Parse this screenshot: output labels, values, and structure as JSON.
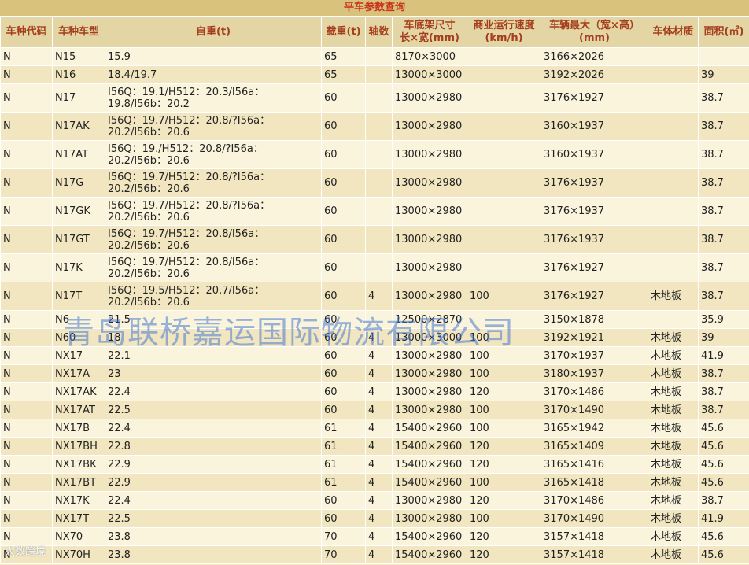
{
  "page": {
    "title": "平车参数查询"
  },
  "table": {
    "headers": [
      "车种代码",
      "车种车型",
      "自重(t)",
      "载重(t)",
      "轴数",
      "车底架尺寸\n长×宽(mm)",
      "商业运行速度\n(km/h)",
      "车辆最大（宽×高）\n(mm)",
      "车体材质",
      "面积(㎡)"
    ],
    "rows": [
      [
        "N",
        "N15",
        "15.9",
        "65",
        "",
        "8170×3000",
        "",
        "3166×2026",
        "",
        ""
      ],
      [
        "N",
        "N16",
        "18.4/19.7",
        "65",
        "",
        "13000×3000",
        "",
        "3192×2026",
        "",
        "39"
      ],
      [
        "N",
        "N17",
        "I56Q：19.1/H512：20.3/I56a：\n19.8/I56b：20.2",
        "60",
        "",
        "13000×2980",
        "",
        "3176×1927",
        "",
        "38.7"
      ],
      [
        "N",
        "N17AK",
        "I56Q：19.7/H512：20.8/?I56a：\n20.2/I56b：20.6",
        "60",
        "",
        "13000×2980",
        "",
        "3160×1937",
        "",
        "38.7"
      ],
      [
        "N",
        "N17AT",
        "I56Q：19./H512：20.8/?I56a：\n20.2/I56b：20.6",
        "60",
        "",
        "13000×2980",
        "",
        "3160×1937",
        "",
        "38.7"
      ],
      [
        "N",
        "N17G",
        "I56Q：19.7/H512：20.8/?I56a：\n20.2/I56b：20.6",
        "60",
        "",
        "13000×2980",
        "",
        "3176×1937",
        "",
        "38.7"
      ],
      [
        "N",
        "N17GK",
        "I56Q：19.7/H512：20.8/?I56a：\n20.2/I56b：20.6",
        "60",
        "",
        "13000×2980",
        "",
        "3176×1937",
        "",
        "38.7"
      ],
      [
        "N",
        "N17GT",
        "I56Q：19.7/H512：20.8/I56a：\n20.2/I56b：20.6",
        "60",
        "",
        "13000×2980",
        "",
        "3176×1937",
        "",
        "38.7"
      ],
      [
        "N",
        "N17K",
        "I56Q：19.7/H512：20.8/I56a：\n20.2/I56b：20.6",
        "60",
        "",
        "13000×2980",
        "",
        "3176×1927",
        "",
        "38.7"
      ],
      [
        "N",
        "N17T",
        "I56Q：19.5/H512：20.7/I56a：\n20.2/I56b：20.6",
        "60",
        "4",
        "13000×2980",
        "100",
        "3176×1927",
        "木地板",
        "38.7"
      ],
      [
        "N",
        "N6",
        "21.5",
        "60",
        "",
        "12500×2870",
        "",
        "3150×1878",
        "",
        "35.9"
      ],
      [
        "N",
        "N60",
        "18",
        "60",
        "4",
        "13000×3000",
        "100",
        "3192×1921",
        "木地板",
        "39"
      ],
      [
        "N",
        "NX17",
        "22.1",
        "60",
        "4",
        "13000×2980",
        "100",
        "3170×1937",
        "木地板",
        "41.9"
      ],
      [
        "N",
        "NX17A",
        "23",
        "60",
        "4",
        "13000×2980",
        "100",
        "3180×1937",
        "木地板",
        "38.7"
      ],
      [
        "N",
        "NX17AK",
        "22.4",
        "60",
        "4",
        "13000×2980",
        "120",
        "3170×1486",
        "木地板",
        "38.7"
      ],
      [
        "N",
        "NX17AT",
        "22.5",
        "60",
        "4",
        "13000×2980",
        "100",
        "3170×1490",
        "木地板",
        "38.7"
      ],
      [
        "N",
        "NX17B",
        "22.4",
        "61",
        "4",
        "15400×2960",
        "100",
        "3165×1942",
        "木地板",
        "45.6"
      ],
      [
        "N",
        "NX17BH",
        "22.8",
        "61",
        "4",
        "15400×2960",
        "120",
        "3165×1409",
        "木地板",
        "45.6"
      ],
      [
        "N",
        "NX17BK",
        "22.9",
        "61",
        "4",
        "15400×2960",
        "120",
        "3165×1416",
        "木地板",
        "45.6"
      ],
      [
        "N",
        "NX17BT",
        "22.9",
        "61",
        "4",
        "15400×2960",
        "100",
        "3165×1418",
        "木地板",
        "45.6"
      ],
      [
        "N",
        "NX17K",
        "22.4",
        "60",
        "4",
        "13000×2980",
        "120",
        "3170×1486",
        "木地板",
        "38.7"
      ],
      [
        "N",
        "NX17T",
        "22.5",
        "60",
        "4",
        "13000×2980",
        "100",
        "3170×1490",
        "木地板",
        "41.9"
      ],
      [
        "N",
        "NX70",
        "23.8",
        "70",
        "4",
        "15400×2960",
        "120",
        "3157×1418",
        "木地板",
        "45.6"
      ],
      [
        "N",
        "NX70H",
        "23.8",
        "70",
        "4",
        "15400×2960",
        "120",
        "3157×1418",
        "木地板",
        "45.6"
      ]
    ]
  },
  "watermark": {
    "text": "青岛联桥嘉运国际物流有限公司"
  },
  "logo": {
    "text": "大数跨境"
  }
}
